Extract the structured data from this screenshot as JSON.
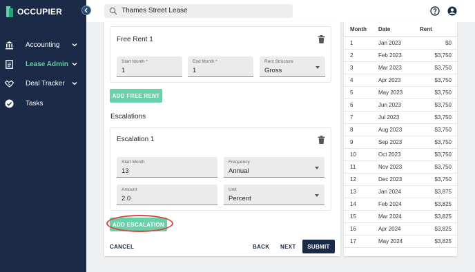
{
  "app": {
    "name": "OCCUPIER"
  },
  "sidebar": {
    "items": [
      {
        "label": "Accounting",
        "icon": "bank-icon",
        "active": false
      },
      {
        "label": "Lease Admin",
        "icon": "document-icon",
        "active": true
      },
      {
        "label": "Deal Tracker",
        "icon": "handshake-icon",
        "active": false
      },
      {
        "label": "Tasks",
        "icon": "check-circle-icon",
        "active": false
      }
    ]
  },
  "search": {
    "value": "Thames Street Lease"
  },
  "free_rent": {
    "title": "Free Rent 1",
    "start_month": {
      "label": "Start Month *",
      "value": "1"
    },
    "end_month": {
      "label": "End Month *",
      "value": "1"
    },
    "rent_structure": {
      "label": "Rent Structure",
      "value": "Gross"
    },
    "add_button": "ADD FREE RENT"
  },
  "escalations": {
    "section_title": "Escalations",
    "title": "Escalation 1",
    "start_month": {
      "label": "Start Month",
      "value": "13"
    },
    "frequency": {
      "label": "Frequency",
      "value": "Annual"
    },
    "amount": {
      "label": "Amount",
      "value": "2.0"
    },
    "unit": {
      "label": "Unit",
      "value": "Percent"
    },
    "add_button": "ADD ESCALATION"
  },
  "footer": {
    "cancel": "CANCEL",
    "back": "BACK",
    "next": "NEXT",
    "submit": "SUBMIT"
  },
  "schedule": {
    "headers": [
      "Month",
      "Date",
      "Rent"
    ],
    "rows": [
      [
        "1",
        "Jan 2023",
        "$0"
      ],
      [
        "2",
        "Feb 2023",
        "$3,750"
      ],
      [
        "3",
        "Mar 2023",
        "$3,750"
      ],
      [
        "4",
        "Apr 2023",
        "$3,750"
      ],
      [
        "5",
        "May 2023",
        "$3,750"
      ],
      [
        "6",
        "Jun 2023",
        "$3,750"
      ],
      [
        "7",
        "Jul 2023",
        "$3,750"
      ],
      [
        "8",
        "Aug 2023",
        "$3,750"
      ],
      [
        "9",
        "Sep 2023",
        "$3,750"
      ],
      [
        "10",
        "Oct 2023",
        "$3,750"
      ],
      [
        "11",
        "Nov 2023",
        "$3,750"
      ],
      [
        "12",
        "Dec 2023",
        "$3,750"
      ],
      [
        "13",
        "Jan 2024",
        "$3,875"
      ],
      [
        "14",
        "Feb 2024",
        "$3,825"
      ],
      [
        "15",
        "Mar 2024",
        "$3,825"
      ],
      [
        "16",
        "Apr 2024",
        "$3,825"
      ],
      [
        "17",
        "May 2024",
        "$3,825"
      ]
    ]
  },
  "colors": {
    "sidebar_bg": "#1a2a47",
    "accent_green": "#68d1a9",
    "active_nav": "#5fd1a4",
    "highlight_ring": "#d7463f"
  }
}
